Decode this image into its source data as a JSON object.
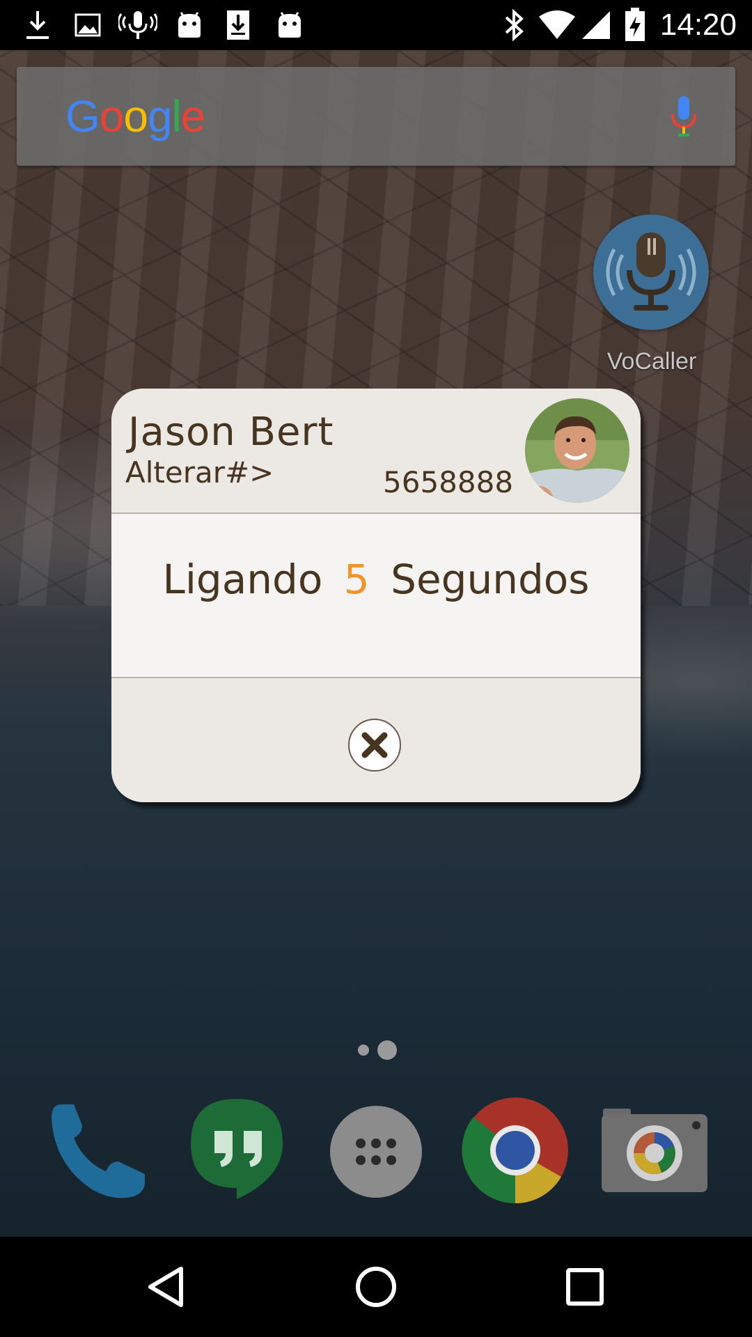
{
  "status_bar": {
    "time": "14:20",
    "left_icons": [
      "download-icon",
      "image-icon",
      "mic-broadcast-icon",
      "android-icon",
      "download-box-icon",
      "android-icon"
    ],
    "right_icons": [
      "bluetooth-icon",
      "wifi-icon",
      "signal-icon",
      "battery-icon"
    ]
  },
  "search": {
    "logo_letters": [
      "G",
      "o",
      "o",
      "g",
      "l",
      "e"
    ],
    "logo_colors": [
      "#4285F4",
      "#EA4335",
      "#FBBC05",
      "#4285F4",
      "#34A853",
      "#EA4335"
    ]
  },
  "widget": {
    "label": "VoCaller"
  },
  "dialog": {
    "contact_name": "Jason Bert",
    "alter_label": "Alterar#>",
    "phone_number": "5658888",
    "status_prefix": "Ligando",
    "seconds": "5",
    "status_suffix": "Segundos"
  },
  "pager": {
    "pages": 2,
    "current": 2
  },
  "dock": {
    "apps": [
      "phone-icon",
      "hangouts-icon",
      "app-drawer-icon",
      "chrome-icon",
      "camera-icon"
    ]
  },
  "navbar": {
    "buttons": [
      "back-icon",
      "home-icon",
      "recents-icon"
    ]
  },
  "colors": {
    "dialog_text": "#47351f",
    "seconds_accent": "#f0952a",
    "vocaller_blue": "#3d6f96"
  }
}
